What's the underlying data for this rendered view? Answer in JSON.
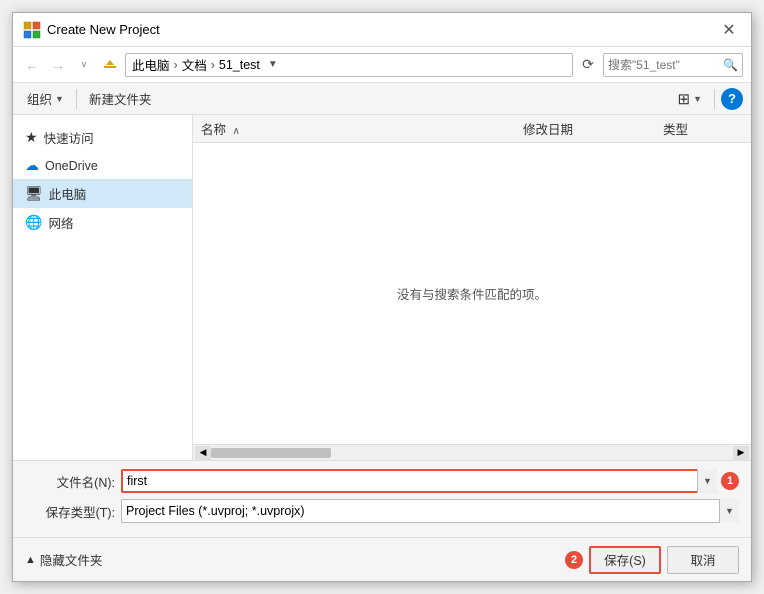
{
  "titleBar": {
    "title": "Create New Project",
    "closeLabel": "✕"
  },
  "navBar": {
    "backLabel": "←",
    "forwardLabel": "→",
    "dropdownLabel": "∨",
    "upLabel": "↑",
    "breadcrumbs": [
      "此电脑",
      "文档",
      "51_test"
    ],
    "refreshLabel": "↻",
    "searchPlaceholder": "搜索\"51_test\"",
    "searchIcon": "🔍"
  },
  "toolbar": {
    "organizeLabel": "组织",
    "newFolderLabel": "新建文件夹",
    "viewLabel": "⊞",
    "helpLabel": "?"
  },
  "fileList": {
    "columns": {
      "name": "名称",
      "date": "修改日期",
      "type": "类型",
      "sortArrow": "∧"
    },
    "emptyMessage": "没有与搜索条件匹配的项。"
  },
  "bottomForm": {
    "fileNameLabel": "文件名(N):",
    "fileNameValue": "first",
    "fileTypeLabel": "保存类型(T):",
    "fileTypeValue": "Project Files (*.uvproj; *.uvprojx)"
  },
  "bottomActions": {
    "hideFolderLabel": "隐藏文件夹",
    "saveLabel": "保存(S)",
    "cancelLabel": "取消",
    "saveBadge": "2"
  }
}
